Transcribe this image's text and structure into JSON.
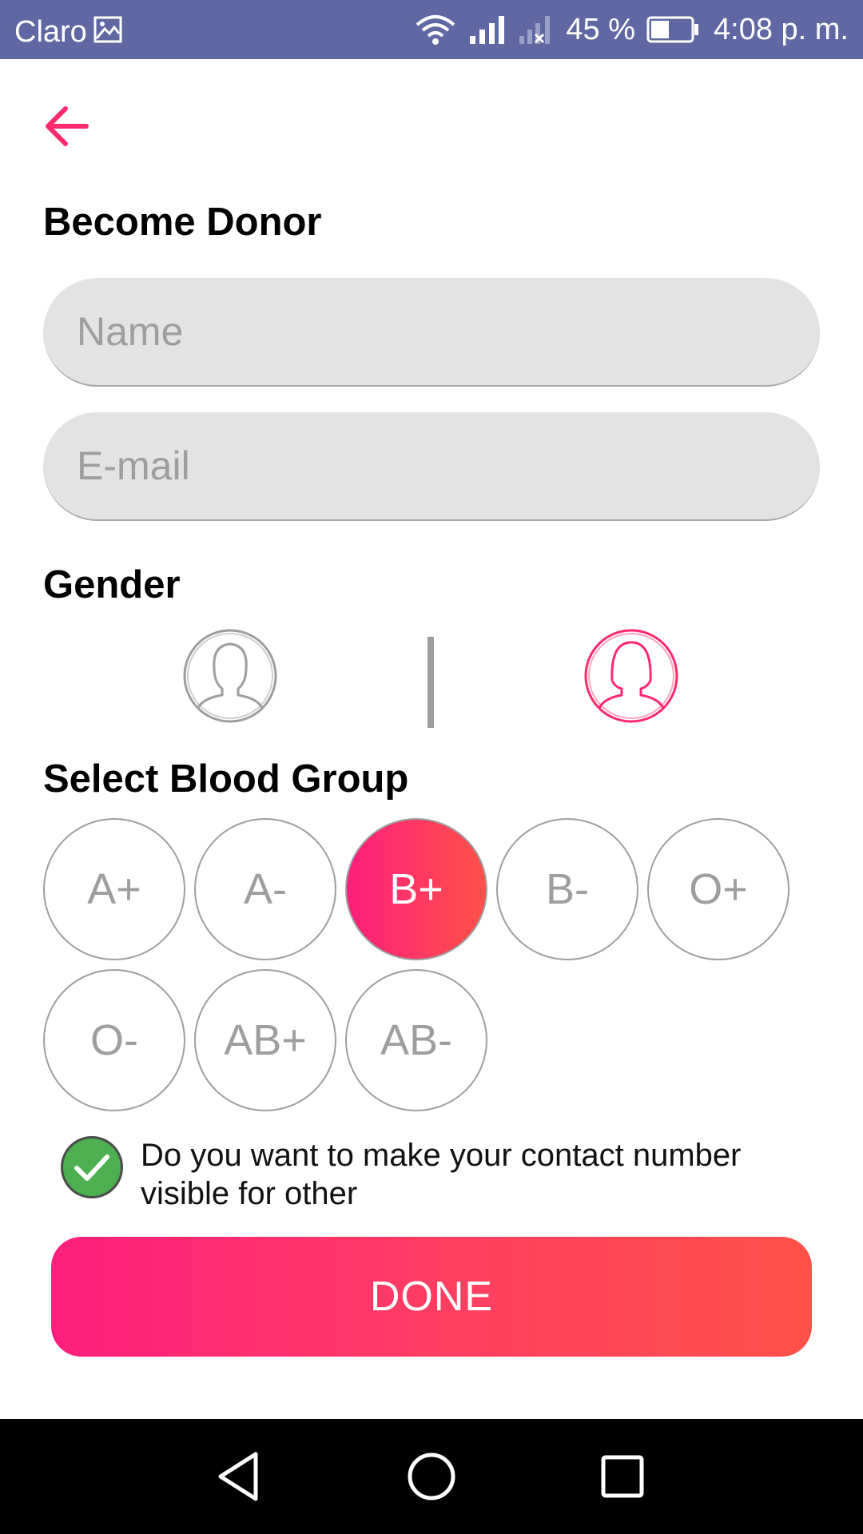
{
  "status_bar": {
    "carrier": "Claro",
    "battery_percent": "45 %",
    "time": "4:08 p. m."
  },
  "page": {
    "title": "Become Donor"
  },
  "form": {
    "name_placeholder": "Name",
    "email_placeholder": "E-mail"
  },
  "gender": {
    "label": "Gender",
    "options": [
      "male",
      "female"
    ],
    "selected": "female"
  },
  "blood_group": {
    "label": "Select Blood Group",
    "options": [
      "A+",
      "A-",
      "B+",
      "B-",
      "O+",
      "O-",
      "AB+",
      "AB-"
    ],
    "selected": "B+"
  },
  "contact_visibility": {
    "checked": true,
    "label": "Do you want to make your contact number visible for other"
  },
  "done_button": {
    "label": "DONE"
  },
  "colors": {
    "status_bar": "#5f68a3",
    "accent_start": "#ff1e7d",
    "accent_end": "#ff5149",
    "check_green": "#4caf50",
    "inactive_gray": "#9e9e9e",
    "input_bg": "#e3e3e3"
  },
  "icons": {
    "back": "arrow-left-icon",
    "male": "male-avatar-icon",
    "female": "female-avatar-icon",
    "checkbox": "checkmark-icon",
    "nav_back": "triangle-back-icon",
    "nav_home": "circle-home-icon",
    "nav_recent": "square-recents-icon"
  }
}
